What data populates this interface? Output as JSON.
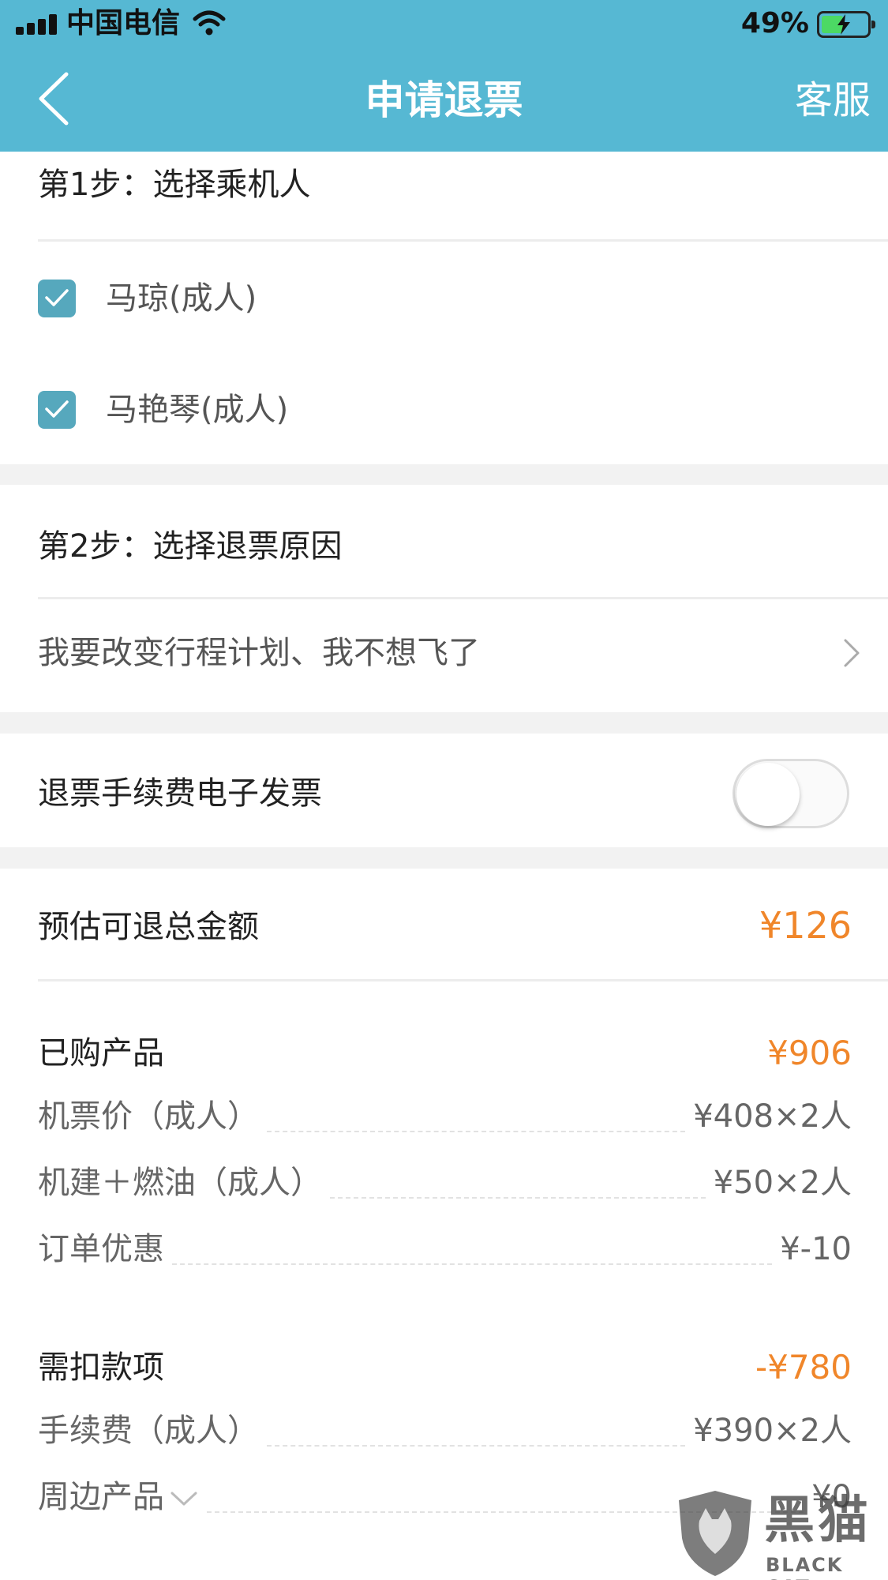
{
  "status_bar": {
    "carrier": "中国电信",
    "battery_percent": "49%",
    "battery_level": 0.49,
    "icons": [
      "signal-icon",
      "wifi-icon",
      "battery-charging-icon"
    ]
  },
  "nav": {
    "title": "申请退票",
    "right_action": "客服",
    "icons": [
      "back-chevron-icon"
    ]
  },
  "step1": {
    "title": "第1步：选择乘机人",
    "passengers": [
      {
        "name": "马琼(成人)",
        "checked": true
      },
      {
        "name": "马艳琴(成人)",
        "checked": true
      }
    ]
  },
  "step2": {
    "title": "第2步：选择退票原因",
    "reason": "我要改变行程计划、我不想飞了"
  },
  "invoice": {
    "label": "退票手续费电子发票",
    "enabled": false
  },
  "summary": {
    "refund_label": "预估可退总金额",
    "refund_value": "¥126",
    "purchased": {
      "label": "已购产品",
      "value": "¥906",
      "items": [
        {
          "label": "机票价（成人）",
          "value": "¥408×2人"
        },
        {
          "label": "机建＋燃油（成人）",
          "value": "¥50×2人"
        },
        {
          "label": "订单优惠",
          "value": "¥-10"
        }
      ]
    },
    "deductions": {
      "label": "需扣款项",
      "value": "-¥780",
      "items": [
        {
          "label": "手续费（成人）",
          "value": "¥390×2人"
        },
        {
          "label": "周边产品",
          "value": "¥0"
        }
      ]
    }
  },
  "colors": {
    "header": "#56b8d3",
    "accent_orange": "#f0862a",
    "checkbox": "#56a8bd"
  },
  "watermark": {
    "cn": "黑猫",
    "en": "BLACK CAT"
  }
}
